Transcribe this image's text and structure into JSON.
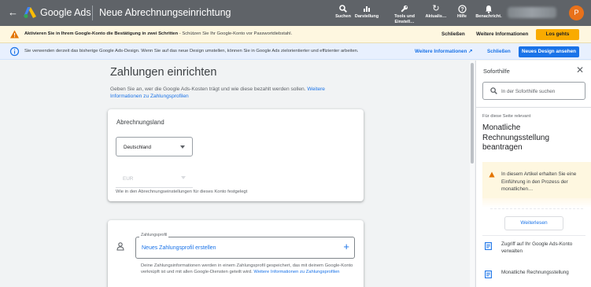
{
  "topbar": {
    "brand": "Google Ads",
    "page_title": "Neue Abrechnungseinrichtung",
    "tools": [
      {
        "label": "Suchen",
        "icon": "search-icon"
      },
      {
        "label": "Darstellung",
        "icon": "chart-icon"
      },
      {
        "label": "Tools und",
        "label2": "Einstell…",
        "icon": "wrench-icon"
      },
      {
        "label": "Aktualis…",
        "icon": "refresh-icon"
      },
      {
        "label": "Hilfe",
        "icon": "help-icon"
      },
      {
        "label": "Benachricht.",
        "icon": "bell-icon"
      }
    ],
    "avatar_letter": "P",
    "avatar_color": "#e8711a"
  },
  "banner_warning": {
    "bold": "Aktivieren Sie in Ihrem Google-Konto die Bestätigung in zwei Schritten",
    "text": " - Schützen Sie Ihr Google-Konto vor Passwortdiebstahl.",
    "dismiss": "Schließen",
    "more": "Weitere Informationen",
    "go": "Los gehts"
  },
  "banner_info": {
    "text": "Sie verwenden derzeit das bisherige Google Ads-Design. Wenn Sie auf das neue Design umstellen, können Sie in Google Ads zielorientierter und effizienter arbeiten.",
    "more": "Weitere Informationen",
    "dismiss": "Schließen",
    "new_design": "Neues Design ansehen"
  },
  "main": {
    "title": "Zahlungen einrichten",
    "subtitle": "Geben Sie an, wer die Google Ads-Kosten trägt und wie diese bezahlt werden sollen.",
    "subtitle_link": "Weitere Informationen zu Zahlungsprofilen",
    "billing_country": {
      "title": "Abrechnungsland",
      "country_value": "Deutschland",
      "currency_value": "EUR",
      "note": "Wie in den Abrechnungseinstellungen für dieses Konto festgelegt"
    },
    "payment_profile": {
      "legend": "Zahlungsprofil",
      "new_label": "Neues Zahlungsprofil erstellen",
      "note": "Deine Zahlungsinformationen werden in einem Zahlungsprofil gespeichert, das mit deinem Google-Konto verknüpft ist und mit allen Google-Diensten geteilt wird.",
      "note_link": "Weitere Informationen zu Zahlungsprofilen"
    }
  },
  "help": {
    "title": "Soforthilfe",
    "search_placeholder": "In der Soforthilfe suchen",
    "relevant_label": "Für diese Seite relevant",
    "article_title": "Monatliche Rechnungsstellung beantragen",
    "article_excerpt": "In diesem Artikel erhalten Sie eine Einführung in den Prozess der monatlichen…",
    "read_more": "Weiterlesen",
    "links": [
      "Zugriff auf Ihr Google Ads-Konto verwalten",
      "Monatliche Rechnungsstellung"
    ]
  },
  "colors": {
    "topbar": "#5f6368",
    "warning_bg": "#fef7e0",
    "info_bg": "#e8f0fe",
    "accent_blue": "#1a73e8",
    "accent_yellow": "#f9ab00"
  }
}
